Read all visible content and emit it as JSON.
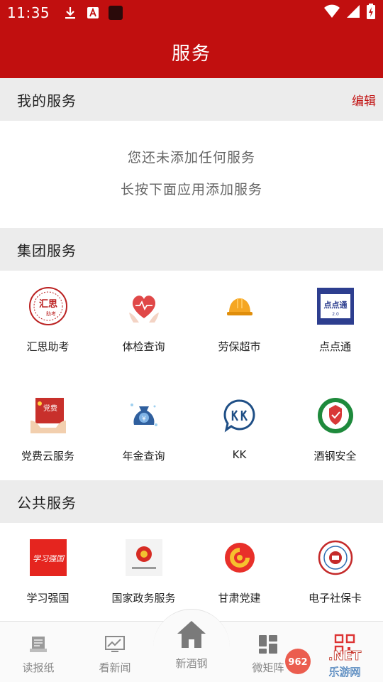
{
  "status_bar": {
    "time": "11:35"
  },
  "app_bar": {
    "title": "服务"
  },
  "my_services": {
    "title": "我的服务",
    "edit_label": "编辑",
    "empty_line1": "您还未添加任何服务",
    "empty_line2": "长按下面应用添加服务"
  },
  "group_services": {
    "title": "集团服务",
    "items": [
      {
        "label": "汇思助考",
        "icon": "huisi-logo-icon"
      },
      {
        "label": "体检查询",
        "icon": "heart-hands-icon"
      },
      {
        "label": "劳保超市",
        "icon": "hard-hat-icon"
      },
      {
        "label": "点点通",
        "icon": "dian-dian-tong-icon"
      },
      {
        "label": "党费云服务",
        "icon": "party-fee-icon"
      },
      {
        "label": "年金查询",
        "icon": "money-bag-icon"
      },
      {
        "label": "KK",
        "icon": "kk-logo-icon"
      },
      {
        "label": "酒钢安全",
        "icon": "safety-emblem-icon"
      }
    ]
  },
  "public_services": {
    "title": "公共服务",
    "items": [
      {
        "label": "学习强国",
        "icon": "xuexi-qiangguo-icon"
      },
      {
        "label": "国家政务服务",
        "icon": "national-emblem-icon"
      },
      {
        "label": "甘肃党建",
        "icon": "gansu-party-icon"
      },
      {
        "label": "电子社保卡",
        "icon": "social-security-icon"
      }
    ]
  },
  "bottom_nav": {
    "items": [
      {
        "label": "读报纸",
        "icon": "newspaper-icon"
      },
      {
        "label": "看新闻",
        "icon": "news-chart-icon"
      },
      {
        "label": "新酒钢",
        "icon": "home-icon"
      },
      {
        "label": "微矩阵",
        "icon": "matrix-icon"
      },
      {
        "label": "",
        "icon": "qr-code-icon"
      }
    ]
  },
  "watermark": {
    "text_top": "962.NET",
    "text_bottom": "乐游网"
  },
  "colors": {
    "brand_red": "#c10f0f",
    "section_bg": "#ececec"
  }
}
